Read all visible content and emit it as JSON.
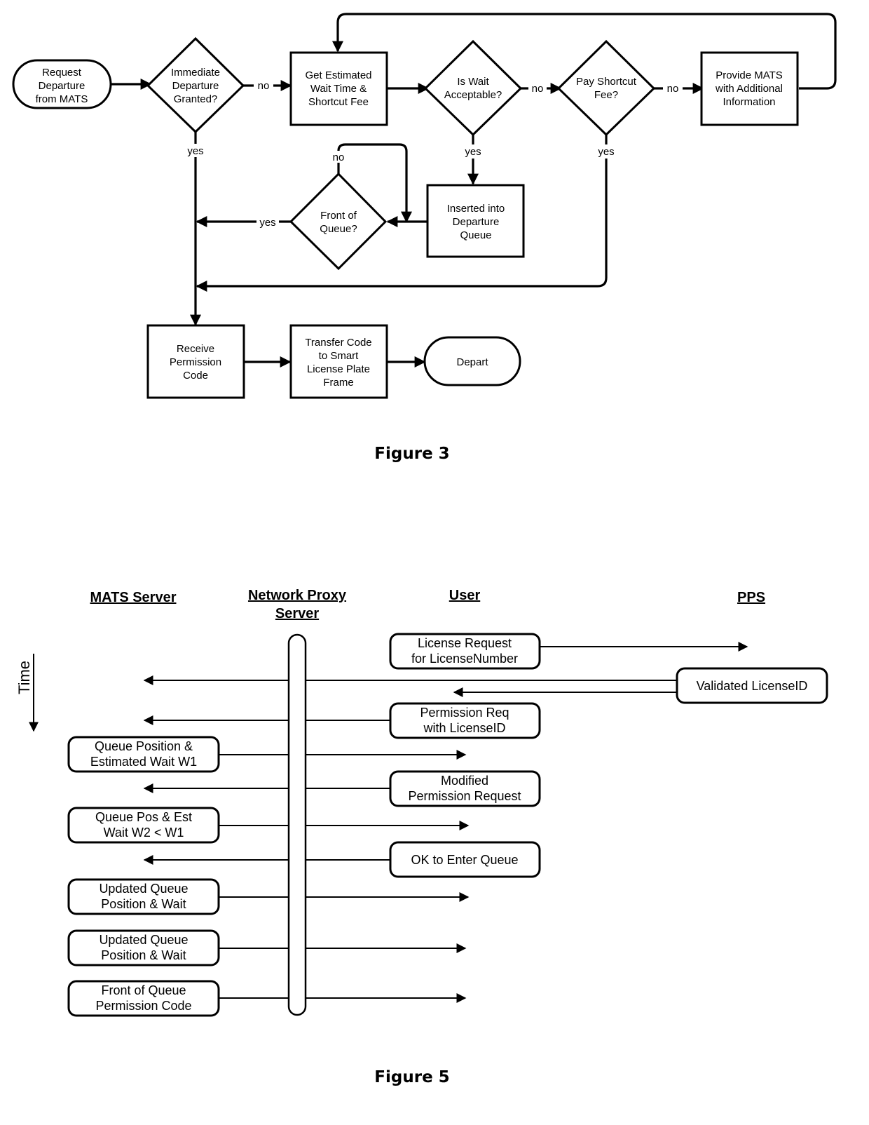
{
  "figure3": {
    "caption": "Figure 3",
    "nodes": {
      "request": [
        "Request",
        "Departure",
        "from MATS"
      ],
      "immediate": [
        "Immediate",
        "Departure",
        "Granted?"
      ],
      "estimate": [
        "Get Estimated",
        "Wait Time &",
        "Shortcut Fee"
      ],
      "wait_ok": [
        "Is Wait",
        "Acceptable?"
      ],
      "pay_fee": [
        "Pay Shortcut",
        "Fee?"
      ],
      "provide": [
        "Provide MATS",
        "with Additional",
        "Information"
      ],
      "front": [
        "Front of",
        "Queue?"
      ],
      "inserted": [
        "Inserted into",
        "Departure",
        "Queue"
      ],
      "receive": [
        "Receive",
        "Permission",
        "Code"
      ],
      "transfer": [
        "Transfer Code",
        "to Smart",
        "License Plate",
        "Frame"
      ],
      "depart": [
        "Depart"
      ]
    },
    "edge_labels": {
      "immediate_no": "no",
      "immediate_yes": "yes",
      "wait_no": "no",
      "wait_yes": "yes",
      "pay_no": "no",
      "pay_yes": "yes",
      "front_no": "no",
      "front_yes": "yes"
    }
  },
  "figure5": {
    "caption": "Figure 5",
    "time_label": "Time",
    "lanes": {
      "mats": "MATS Server",
      "proxy": [
        "Network Proxy",
        "Server"
      ],
      "user": "User",
      "pps": "PPS"
    },
    "messages": {
      "license_request": [
        "License Request",
        "for LicenseNumber"
      ],
      "validated": [
        "Validated LicenseID"
      ],
      "permission_req": [
        "Permission Req",
        "with LicenseID"
      ],
      "queue_pos_w1": [
        "Queue Position &",
        "Estimated Wait W1"
      ],
      "modified": [
        "Modified",
        "Permission Request"
      ],
      "queue_pos_w2": [
        "Queue Pos & Est",
        "Wait  W2 < W1"
      ],
      "ok_enter": [
        "OK to Enter Queue"
      ],
      "updated1": [
        "Updated Queue",
        "Position & Wait"
      ],
      "updated2": [
        "Updated Queue",
        "Position & Wait"
      ],
      "front_code": [
        "Front of Queue",
        "Permission Code"
      ]
    }
  }
}
